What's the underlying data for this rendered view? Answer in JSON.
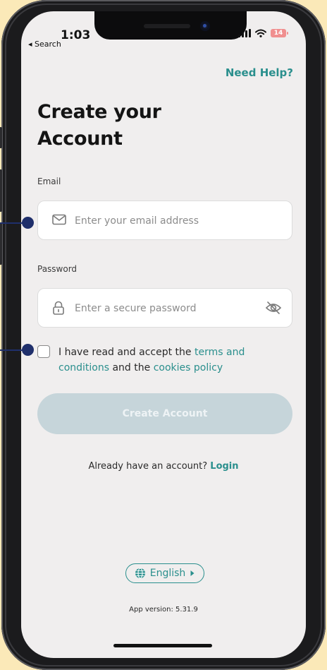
{
  "status_bar": {
    "time": "1:03",
    "back_label": "◂ Search",
    "battery": "14"
  },
  "header": {
    "need_help": "Need Help?"
  },
  "title_line1": "Create your",
  "title_line2": "Account",
  "email": {
    "label": "Email",
    "placeholder": "Enter your email address",
    "icon": "mail-icon"
  },
  "password": {
    "label": "Password",
    "placeholder": "Enter a secure password",
    "icon": "lock-icon",
    "toggle_icon": "eye-off-icon"
  },
  "terms": {
    "prefix": "I have read and accept the ",
    "terms_link": "terms and conditions",
    "middle": " and the ",
    "cookies_link": "cookies policy"
  },
  "create_button": "Create Account",
  "login": {
    "prompt": "Already have an account? ",
    "link": "Login"
  },
  "language": {
    "value": "English",
    "icon": "globe-icon"
  },
  "app_version": "App version: 5.31.9",
  "colors": {
    "accent": "#2a8f8d",
    "button_disabled": "#c6d5da",
    "background": "#f0eeee",
    "annotation_dot": "#1f2f6b"
  }
}
